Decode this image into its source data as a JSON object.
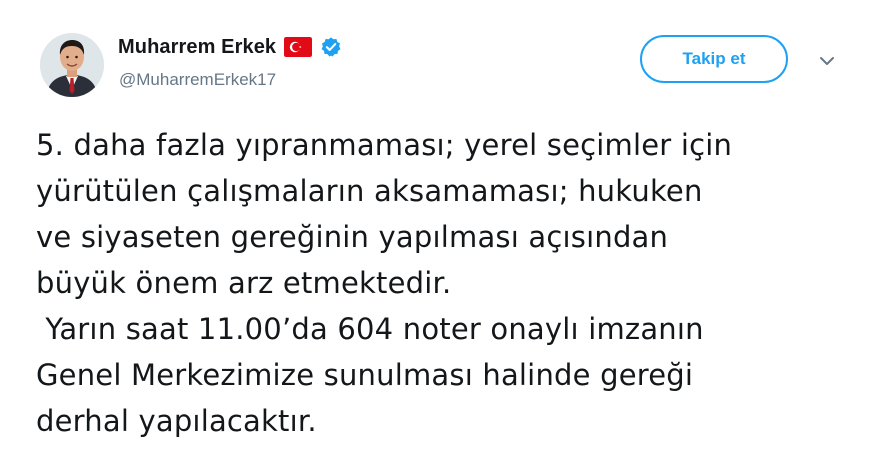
{
  "author": {
    "display_name": "Muharrem Erkek",
    "handle": "@MuharremErkek17",
    "verified": true,
    "flag": "turkey-flag-icon",
    "avatar": "avatar"
  },
  "actions": {
    "follow_label": "Takip et",
    "more_icon": "chevron-down-icon"
  },
  "tweet": {
    "lines": [
      "5. daha fazla yıpranmaması; yerel seçimler için",
      "yürütülen çalışmaların aksamaması; hukuken",
      "ve siyaseten gereğinin yapılması açısından",
      "büyük önem arz etmektedir.",
      " Yarın saat 11.00’da 604 noter onaylı imzanın",
      "Genel Merkezimize sunulması halinde gereği",
      "derhal yapılacaktır."
    ]
  },
  "colors": {
    "accent": "#1da1f2",
    "text": "#14171a",
    "secondary": "#657786",
    "flag_red": "#e30a17"
  }
}
